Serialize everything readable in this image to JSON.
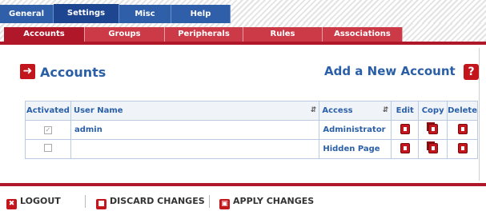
{
  "top_tabs": [
    "General",
    "Settings",
    "Misc",
    "Help"
  ],
  "sub_tabs": [
    "Accounts",
    "Groups",
    "Peripherals",
    "Rules",
    "Associations"
  ],
  "page": {
    "heading": "Accounts",
    "add_link": "Add a New Account",
    "help": "?"
  },
  "table": {
    "headers": {
      "activated": "Activated",
      "user_name": "User Name",
      "access": "Access",
      "edit": "Edit",
      "copy": "Copy",
      "delete": "Delete"
    },
    "rows": [
      {
        "activated": true,
        "user_name": "admin",
        "access": "Administrator"
      },
      {
        "activated": false,
        "user_name": "",
        "access": "Hidden Page"
      }
    ]
  },
  "bottom": {
    "logout": "LOGOUT",
    "discard": "DISCARD CHANGES",
    "apply": "APPLY CHANGES"
  },
  "colors": {
    "primary_blue": "#2f5fa8",
    "accent_red": "#b0182a"
  }
}
